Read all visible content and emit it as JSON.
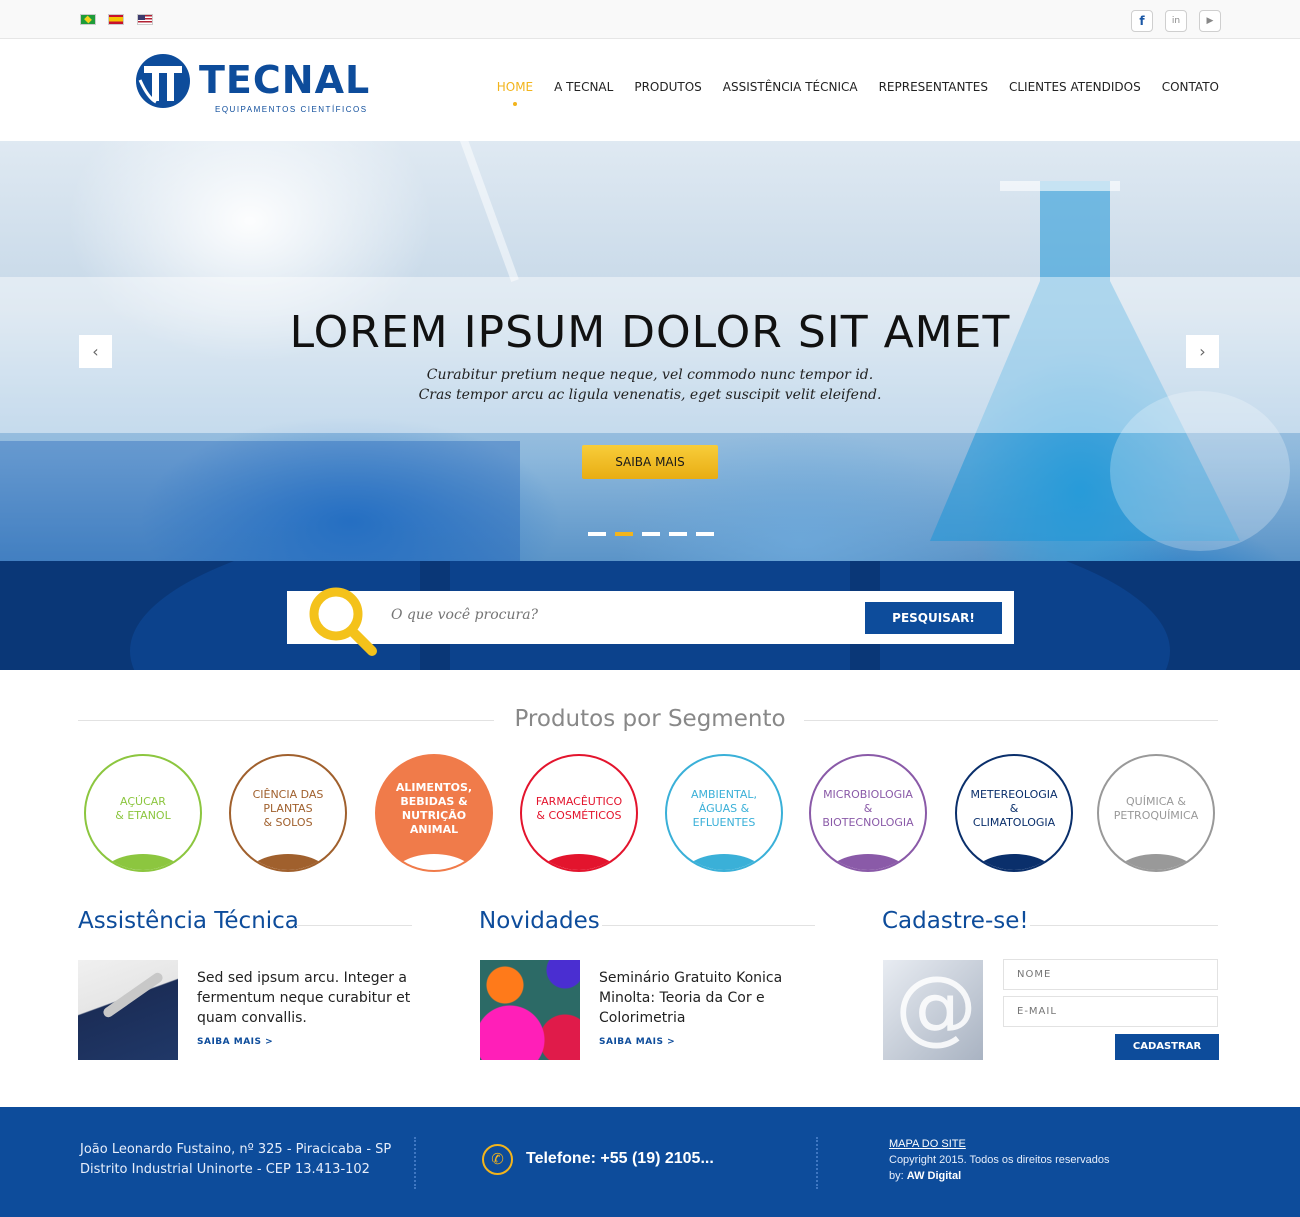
{
  "topbar": {
    "flags": [
      "brazil-flag",
      "spain-flag",
      "usa-flag"
    ],
    "social": {
      "facebook": "f",
      "linkedin": "in",
      "youtube": "▶"
    }
  },
  "brand": {
    "name": "TECNAL",
    "tagline": "EQUIPAMENTOS CIENTÍFICOS",
    "color": "#0d4c9b"
  },
  "nav": {
    "items": [
      "HOME",
      "A TECNAL",
      "PRODUTOS",
      "ASSISTÊNCIA TÉCNICA",
      "REPRESENTANTES",
      "CLIENTES ATENDIDOS",
      "CONTATO"
    ],
    "active": "HOME",
    "accent": "#f2b41c"
  },
  "hero": {
    "title": "LOREM IPSUM DOLOR SIT AMET",
    "subtitle_line1": "Curabitur pretium neque neque, vel commodo nunc tempor id.",
    "subtitle_line2": "Cras tempor arcu ac ligula venenatis, eget suscipit velit eleifend.",
    "button": "SAIBA MAIS",
    "prev": "‹",
    "next": "›",
    "slides": 5,
    "active_slide": 2
  },
  "search": {
    "placeholder": "O que você procura?",
    "button": "PESQUISAR!"
  },
  "segments": {
    "title": "Produtos por Segmento",
    "items": [
      {
        "label": "AÇÚCAR\n& ETANOL",
        "color": "#8cc63f"
      },
      {
        "label": "CIÊNCIA DAS\nPLANTAS\n& SOLOS",
        "color": "#a0602d"
      },
      {
        "label": "ALIMENTOS,\nBEBIDAS &\nNUTRIÇÃO\nANIMAL",
        "color": "#f07b4a"
      },
      {
        "label": "FARMACÊUTICO\n& COSMÉTICOS",
        "color": "#e3142d"
      },
      {
        "label": "AMBIENTAL,\nÁGUAS &\nEFLUENTES",
        "color": "#3ab0d8"
      },
      {
        "label": "MICROBIOLOGIA\n& BIOTECNOLOGIA",
        "color": "#8a5aa8"
      },
      {
        "label": "METEREOLOGIA\n& CLIMATOLOGIA",
        "color": "#0a2f6b"
      },
      {
        "label": "QUÍMICA &\nPETROQUÍMICA",
        "color": "#999999"
      }
    ]
  },
  "assistencia": {
    "title": "Assistência Técnica",
    "text": "Sed sed ipsum arcu. Integer a fermentum neque curabitur et quam convallis.",
    "link": "SAIBA MAIS >"
  },
  "novidades": {
    "title": "Novidades",
    "text": "Seminário Gratuito Konica Minolta: Teoria da Cor e Colorimetria",
    "link": "SAIBA MAIS >"
  },
  "cadastro": {
    "title": "Cadastre-se!",
    "name_placeholder": "NOME",
    "email_placeholder": "E-MAIL",
    "button": "CADASTRAR",
    "image_glyph": "@"
  },
  "footer": {
    "address_line1": "João Leonardo Fustaino, nº 325 - Piracicaba - SP",
    "address_line2": "Distrito Industrial Uninorte - CEP 13.413-102",
    "phone": "Telefone: +55 (19) 2105...",
    "sitemap": "MAPA DO SITE",
    "copyright": "Copyright 2015. Todos os direitos reservados",
    "by_label": "by: ",
    "by_name": "AW Digital"
  }
}
